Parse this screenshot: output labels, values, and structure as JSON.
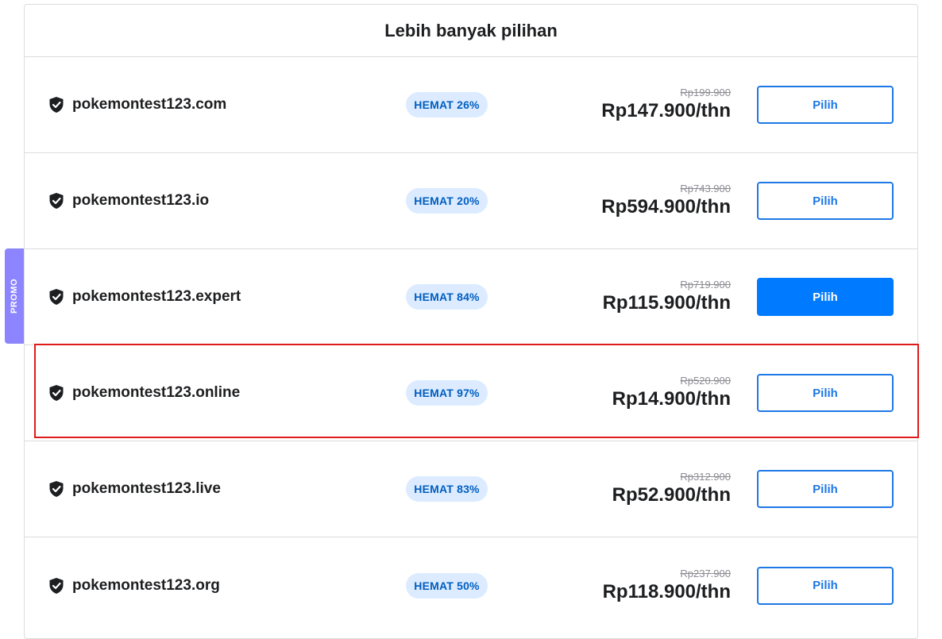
{
  "header": {
    "title": "Lebih banyak pilihan"
  },
  "promo_tab": {
    "label": "PROMO"
  },
  "colors": {
    "accent": "#007aff",
    "badge_bg": "#dcebff",
    "badge_text": "#005ec0",
    "promo": "#8c85ff",
    "highlight": "#e01b1b"
  },
  "domains": [
    {
      "name": "pokemontest123.com",
      "badge": "HEMAT 26%",
      "old_price": "Rp199.900",
      "price": "Rp147.900/thn",
      "button": "Pilih",
      "selected": false
    },
    {
      "name": "pokemontest123.io",
      "badge": "HEMAT 20%",
      "old_price": "Rp743.900",
      "price": "Rp594.900/thn",
      "button": "Pilih",
      "selected": false
    },
    {
      "name": "pokemontest123.expert",
      "badge": "HEMAT 84%",
      "old_price": "Rp719.900",
      "price": "Rp115.900/thn",
      "button": "Pilih",
      "selected": true
    },
    {
      "name": "pokemontest123.online",
      "badge": "HEMAT 97%",
      "old_price": "Rp520.900",
      "price": "Rp14.900/thn",
      "button": "Pilih",
      "selected": false
    },
    {
      "name": "pokemontest123.live",
      "badge": "HEMAT 83%",
      "old_price": "Rp312.900",
      "price": "Rp52.900/thn",
      "button": "Pilih",
      "selected": false
    },
    {
      "name": "pokemontest123.org",
      "badge": "HEMAT 50%",
      "old_price": "Rp237.900",
      "price": "Rp118.900/thn",
      "button": "Pilih",
      "selected": false
    }
  ]
}
